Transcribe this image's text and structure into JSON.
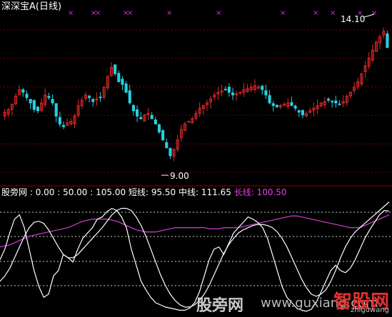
{
  "header": {
    "title": "深深宝A",
    "period": "(日线)"
  },
  "annotations": {
    "high_label": "14.10",
    "low_label": "9.00"
  },
  "indicator": {
    "name": "股旁网",
    "levels": ": 0.00 : 50.00 : 105.00",
    "short_label": "短线:",
    "short_value": "95.50",
    "mid_label": "中线:",
    "mid_value": "111.65",
    "long_label": "长线:",
    "long_value": "100.50"
  },
  "watermark": {
    "text_cn": "股旁网",
    "url": "www.guxiang.com",
    "logo": "智股网",
    "logo_sub": "zhiguwang"
  },
  "colors": {
    "up": "#e02828",
    "down": "#29d0e0",
    "short": "#ffffff",
    "mid": "#ffffff",
    "long": "#d040d0",
    "marker": "#d030d0"
  },
  "chart_data": [
    {
      "type": "candlestick",
      "title": "深深宝A (日线)",
      "ylim": [
        8.4,
        14.6
      ],
      "marked_high": 14.1,
      "marked_low": 9.0,
      "closes": [
        10.95,
        11.05,
        11.25,
        11.55,
        11.8,
        11.7,
        11.5,
        11.3,
        11.05,
        11.0,
        11.3,
        11.6,
        11.5,
        11.3,
        10.8,
        10.5,
        10.4,
        10.55,
        10.6,
        10.8,
        11.2,
        11.4,
        11.6,
        11.5,
        11.35,
        11.45,
        11.5,
        11.9,
        12.3,
        12.65,
        12.4,
        12.1,
        12.0,
        11.7,
        11.3,
        11.0,
        10.8,
        10.7,
        10.85,
        10.9,
        10.7,
        10.5,
        10.2,
        9.9,
        9.6,
        9.3,
        9.55,
        9.9,
        10.3,
        10.5,
        10.6,
        10.7,
        10.9,
        11.1,
        11.2,
        11.3,
        11.45,
        11.6,
        11.7,
        11.75,
        11.8,
        11.7,
        11.6,
        11.65,
        11.7,
        11.8,
        11.85,
        11.9,
        11.95,
        11.9,
        11.8,
        11.6,
        11.3,
        11.2,
        11.15,
        11.2,
        11.25,
        11.3,
        11.2,
        11.1,
        10.95,
        10.85,
        10.9,
        11.0,
        11.1,
        11.2,
        11.3,
        11.35,
        11.4,
        11.35,
        11.3,
        11.25,
        11.35,
        11.55,
        11.7,
        11.9,
        12.1,
        12.4,
        12.7,
        13.0,
        13.3,
        13.6,
        13.8,
        14.0,
        13.4
      ],
      "markers_top_count": 8
    },
    {
      "type": "line",
      "ylim": [
        0,
        105
      ],
      "levels": [
        0,
        50,
        105
      ],
      "series": [
        {
          "name": "短线",
          "last": 95.5,
          "values": [
            50,
            60,
            75,
            88,
            92,
            80,
            60,
            40,
            25,
            15,
            18,
            35,
            40,
            55,
            52,
            48,
            60,
            70,
            75,
            80,
            88,
            90,
            95,
            98,
            96,
            90,
            80,
            60,
            45,
            30,
            22,
            15,
            10,
            8,
            6,
            5,
            4,
            3,
            3,
            5,
            10,
            20,
            35,
            50,
            60,
            62,
            55,
            65,
            75,
            80,
            85,
            90,
            88,
            85,
            80,
            70,
            55,
            40,
            25,
            15,
            10,
            5,
            3,
            2,
            4,
            10,
            20,
            30,
            40,
            45,
            40,
            38,
            42,
            50,
            60,
            70,
            78,
            85,
            92,
            96,
            95.5
          ]
        },
        {
          "name": "中线",
          "last": 111.65,
          "values": [
            30,
            35,
            42,
            52,
            62,
            72,
            80,
            85,
            86,
            84,
            78,
            70,
            62,
            55,
            52,
            52,
            55,
            60,
            65,
            70,
            75,
            80,
            86,
            92,
            96,
            98,
            98,
            96,
            90,
            82,
            72,
            60,
            48,
            36,
            26,
            18,
            12,
            8,
            6,
            6,
            8,
            12,
            18,
            26,
            36,
            46,
            56,
            64,
            70,
            75,
            78,
            80,
            82,
            83,
            83,
            82,
            80,
            76,
            70,
            62,
            52,
            42,
            32,
            24,
            18,
            16,
            18,
            22,
            30,
            40,
            52,
            62,
            70,
            76,
            80,
            84,
            88,
            92,
            96,
            100,
            104
          ]
        },
        {
          "name": "长线",
          "last": 100.5,
          "values": [
            62,
            63,
            64,
            66,
            68,
            70,
            72,
            73,
            74,
            75,
            76,
            77,
            78,
            79,
            80,
            82,
            84,
            86,
            87,
            88,
            88,
            88,
            88,
            87,
            86,
            84,
            82,
            80,
            78,
            77,
            76,
            76,
            76,
            77,
            78,
            79,
            80,
            80,
            80,
            80,
            80,
            80,
            80,
            79,
            79,
            79,
            80,
            80,
            80,
            80,
            81,
            82,
            83,
            84,
            85,
            86,
            87,
            88,
            89,
            90,
            91,
            91,
            90,
            89,
            88,
            87,
            86,
            85,
            84,
            83,
            82,
            81,
            80,
            80,
            80,
            82,
            84,
            86,
            88,
            90,
            92
          ]
        }
      ]
    }
  ]
}
